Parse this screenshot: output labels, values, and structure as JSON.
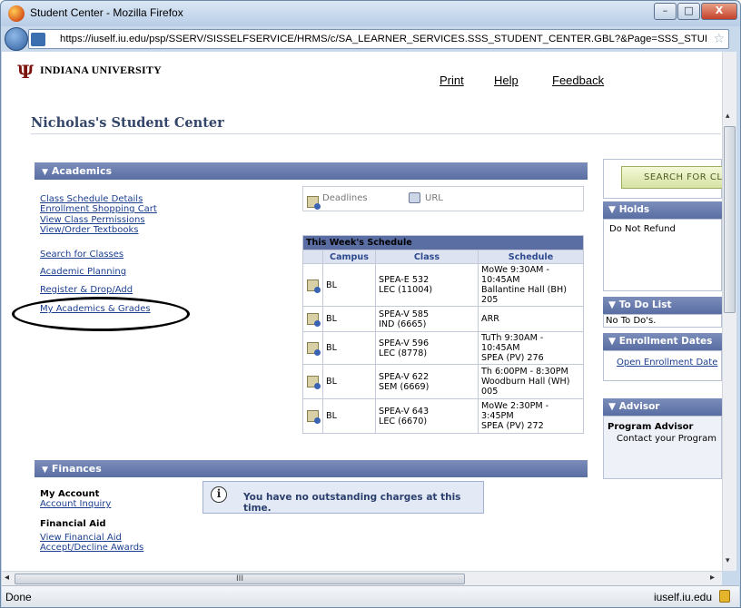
{
  "window": {
    "title": "Student Center - Mozilla Firefox",
    "minimize_symbol": "–",
    "maximize_symbol": "□",
    "close_symbol": "X"
  },
  "addressbar": {
    "url": "https://iuself.iu.edu/psp/SSERV/SISSELFSERVICE/HRMS/c/SA_LEARNER_SERVICES.SSS_STUDENT_CENTER.GBL?&Page=SSS_STUDENT_CEN",
    "star_icon": "☆"
  },
  "header": {
    "logo_mark": "Ψ",
    "university_name": "INDIANA UNIVERSITY",
    "links": {
      "print": "Print",
      "help": "Help",
      "feedback": "Feedback"
    }
  },
  "page_title": "Nicholas's Student Center",
  "academics": {
    "header": "Academics",
    "links": [
      "Class Schedule Details",
      "Enrollment Shopping Cart",
      "View Class Permissions",
      "View/Order Textbooks",
      "Search for Classes",
      "Academic Planning",
      "Register & Drop/Add",
      "My Academics & Grades"
    ],
    "deadlines_label": "Deadlines",
    "url_label": "URL",
    "schedule": {
      "caption": "This Week's Schedule",
      "columns": [
        "Campus",
        "Class",
        "Schedule"
      ],
      "rows": [
        {
          "campus": "BL",
          "class": [
            "SPEA-E 532",
            "LEC (11004)"
          ],
          "schedule": [
            "MoWe 9:30AM -",
            "10:45AM",
            "Ballantine Hall (BH)",
            "205"
          ]
        },
        {
          "campus": "BL",
          "class": [
            "SPEA-V 585",
            "IND (6665)"
          ],
          "schedule": [
            "ARR"
          ]
        },
        {
          "campus": "BL",
          "class": [
            "SPEA-V 596",
            "LEC (8778)"
          ],
          "schedule": [
            "TuTh 9:30AM -",
            "10:45AM",
            "SPEA (PV) 276"
          ]
        },
        {
          "campus": "BL",
          "class": [
            "SPEA-V 622",
            "SEM (6669)"
          ],
          "schedule": [
            "Th 6:00PM - 8:30PM",
            "Woodburn Hall (WH)",
            "005"
          ]
        },
        {
          "campus": "BL",
          "class": [
            "SPEA-V 643",
            "LEC (6670)"
          ],
          "schedule": [
            "MoWe 2:30PM -",
            "3:45PM",
            "SPEA (PV) 272"
          ]
        }
      ]
    }
  },
  "sidebar": {
    "search_button": "SEARCH FOR CLA",
    "holds": {
      "header": "Holds",
      "item": "Do Not Refund"
    },
    "todo": {
      "header": "To Do List",
      "item": "No To Do's."
    },
    "enrollment_dates": {
      "header": "Enrollment Dates",
      "link": "Open Enrollment Date"
    },
    "advisor": {
      "header": "Advisor",
      "title": "Program Advisor",
      "text": "Contact your Program"
    }
  },
  "finances": {
    "header": "Finances",
    "my_account_label": "My Account",
    "account_inquiry": "Account Inquiry",
    "financial_aid_label": "Financial Aid",
    "view_financial_aid": "View Financial Aid",
    "accept_decline": "Accept/Decline Awards",
    "message": "You have no outstanding charges at this time."
  },
  "scroll": {
    "hthumb_grip": "III",
    "left_arrow": "◂",
    "right_arrow": "▸",
    "up_arrow": "▴",
    "down_arrow": "▾"
  },
  "status": {
    "text": "Done",
    "domain": "iuself.iu.edu"
  }
}
